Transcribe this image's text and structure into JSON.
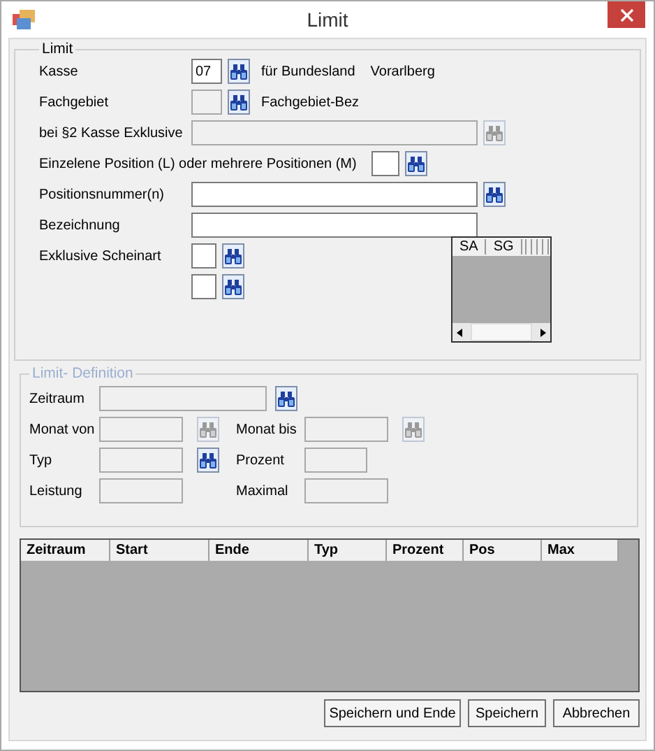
{
  "window": {
    "title": "Limit"
  },
  "limit": {
    "caption": "Limit",
    "kasse": {
      "label": "Kasse",
      "value": "07",
      "disabled": false,
      "search": {
        "disabled": false
      },
      "bundesland_label": "für Bundesland",
      "bundesland": "Vorarlberg"
    },
    "fachgebiet": {
      "label": "Fachgebiet",
      "disabled": true,
      "search": {
        "disabled": false
      },
      "description": "Fachgebiet-Bez"
    },
    "kasse_exklusive": {
      "label": "bei §2 Kasse Exklusive",
      "disabled": true,
      "search": {
        "disabled": true
      }
    },
    "position_type": {
      "label": "Einzelene Position (L) oder mehrere Positionen (M)",
      "disabled": false,
      "search": {
        "disabled": false
      }
    },
    "positionsnummer": {
      "label": "Positionsnummer(n)",
      "disabled": false,
      "search": {
        "disabled": false
      }
    },
    "bezeichnung": {
      "label": "Bezeichnung",
      "disabled": false
    },
    "scheinart": {
      "label": "Exklusive Scheinart",
      "fields": [
        {
          "disabled": false,
          "search": {
            "disabled": false
          }
        },
        {
          "disabled": false,
          "search": {
            "disabled": false
          }
        }
      ]
    },
    "scheinart_grid": {
      "columns": [
        "SA",
        "SG"
      ]
    }
  },
  "definition": {
    "caption": "Limit- Definition",
    "disabled": true,
    "zeitraum": {
      "label": "Zeitraum",
      "disabled": true,
      "search": {
        "disabled": false
      }
    },
    "monat_von": {
      "label": "Monat von",
      "disabled": true,
      "search": {
        "disabled": true
      }
    },
    "monat_bis": {
      "label": "Monat bis",
      "disabled": true,
      "search": {
        "disabled": true
      }
    },
    "typ": {
      "label": "Typ",
      "disabled": true,
      "search": {
        "disabled": false
      }
    },
    "prozent": {
      "label": "Prozent",
      "disabled": true
    },
    "leistung": {
      "label": "Leistung",
      "disabled": true
    },
    "maximal": {
      "label": "Maximal",
      "disabled": true
    }
  },
  "table": {
    "columns": [
      "Zeitraum",
      "Start",
      "Ende",
      "Typ",
      "Prozent",
      "Pos",
      "Max"
    ]
  },
  "buttons": [
    "Speichern und Ende",
    "Speichern",
    "Abbrechen"
  ]
}
